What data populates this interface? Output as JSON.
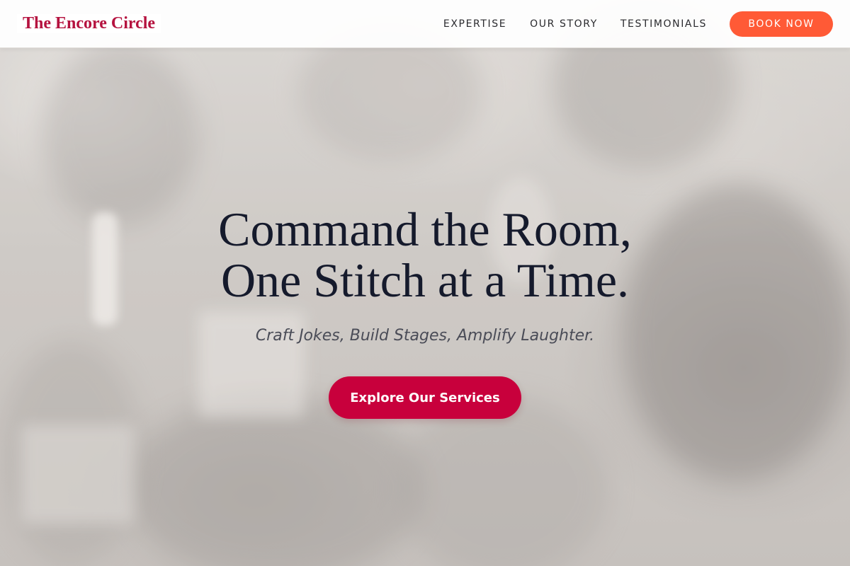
{
  "brand": {
    "name": "The Encore Circle",
    "color": "#b5123f"
  },
  "nav": {
    "links": [
      "EXPERTISE",
      "OUR STORY",
      "TESTIMONIALS"
    ],
    "cta_label": "BOOK NOW",
    "cta_color": "#ff5a36"
  },
  "hero": {
    "headline_line1": "Command the Room,",
    "headline_line2": "One Stitch at a Time.",
    "subheadline": "Craft Jokes, Build Stages, Amplify Laughter.",
    "cta_label": "Explore Our Services",
    "cta_color": "#c8003c",
    "background": "blurred-banquet-photo"
  }
}
